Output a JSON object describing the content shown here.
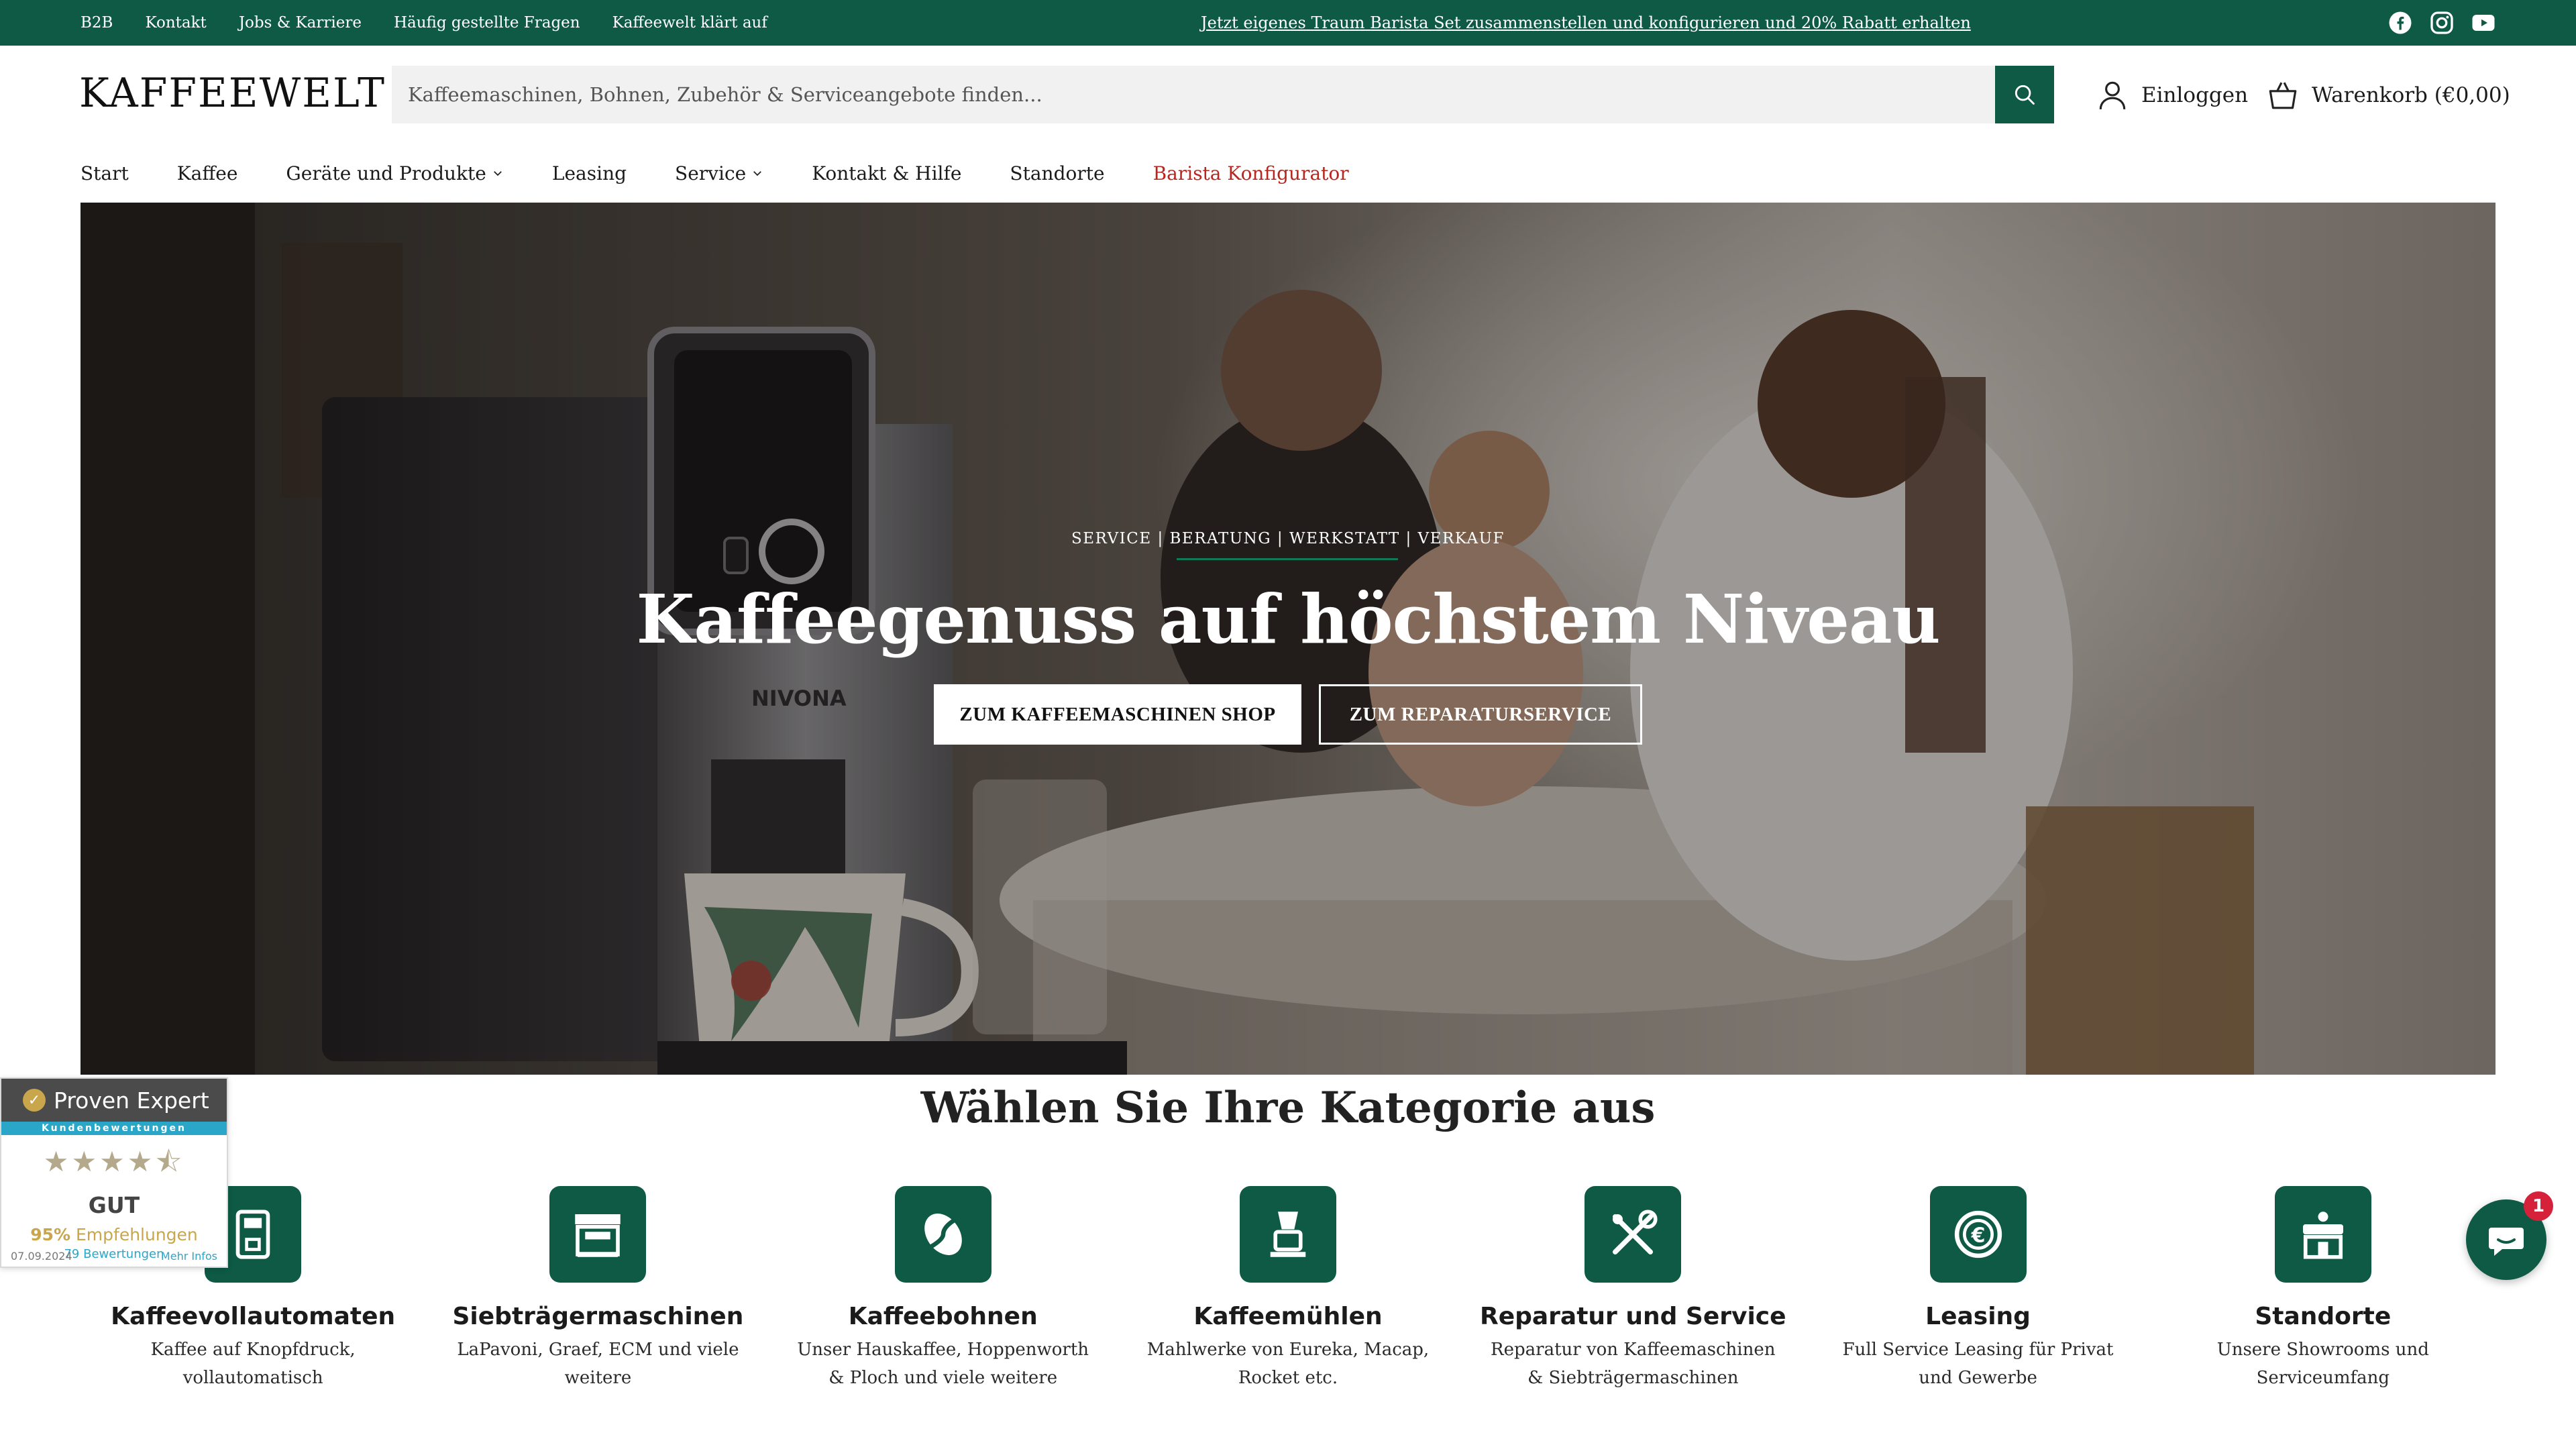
{
  "topbar": {
    "links": [
      "B2B",
      "Kontakt",
      "Jobs & Karriere",
      "Häufig gestellte Fragen",
      "Kaffeewelt klärt auf"
    ],
    "promo": "Jetzt eigenes Traum Barista Set zusammenstellen und konfigurieren und 20% Rabatt erhalten",
    "social_icons": [
      "facebook-icon",
      "instagram-icon",
      "youtube-icon"
    ]
  },
  "header": {
    "logo": "KAFFEEWELT",
    "search_placeholder": "Kaffeemaschinen, Bohnen, Zubehör & Serviceangebote finden...",
    "login": "Einloggen",
    "cart": "Warenkorb (€0,00)"
  },
  "nav": {
    "items": [
      {
        "label": "Start"
      },
      {
        "label": "Kaffee"
      },
      {
        "label": "Geräte und Produkte"
      },
      {
        "label": "Leasing"
      },
      {
        "label": "Service"
      },
      {
        "label": "Kontakt & Hilfe"
      },
      {
        "label": "Standorte"
      },
      {
        "label": "Barista Konfigurator"
      }
    ]
  },
  "hero": {
    "eyebrow": "SERVICE | BERATUNG | WERKSTATT | VERKAUF",
    "title": "Kaffeegenuss auf höchstem Niveau",
    "button_shop": "ZUM KAFFEEMASCHINEN SHOP",
    "button_repair": "ZUM REPARATURSERVICE",
    "machine_brand": "NIVONA"
  },
  "categories": {
    "title": "Wählen Sie Ihre Kategorie aus",
    "items": [
      {
        "name": "Kaffeevollautomaten",
        "desc": "Kaffee auf Knopfdruck, vollautomatisch",
        "icon": "coffee-machine-icon"
      },
      {
        "name": "Siebträgermaschinen",
        "desc": "LaPavoni, Graef, ECM und viele weitere",
        "icon": "espresso-machine-icon"
      },
      {
        "name": "Kaffeebohnen",
        "desc": "Unser Hauskaffee, Hoppenworth & Ploch und viele weitere",
        "icon": "coffee-bean-icon"
      },
      {
        "name": "Kaffeemühlen",
        "desc": "Mahlwerke von Eureka, Macap, Rocket etc.",
        "icon": "grinder-icon"
      },
      {
        "name": "Reparatur und Service",
        "desc": "Reparatur von Kaffeemaschinen & Siebträgermaschinen",
        "icon": "tools-icon"
      },
      {
        "name": "Leasing",
        "desc": "Full Service Leasing für Privat und Gewerbe",
        "icon": "euro-coin-icon"
      },
      {
        "name": "Standorte",
        "desc": "Unsere Showrooms und Serviceumfang",
        "icon": "store-icon"
      }
    ]
  },
  "proven_expert": {
    "brand": "Proven Expert",
    "strip": "Kundenbewertungen",
    "rating_stars": 4.5,
    "grade": "GUT",
    "percent": "95%",
    "recommend": "Empfehlungen",
    "count": "79 Bewertungen",
    "date": "07.09.2024",
    "more": "Mehr Infos"
  },
  "chat": {
    "badge": "1"
  },
  "colors": {
    "brand_green": "#0e5a45",
    "accent_red": "#b7261f"
  }
}
